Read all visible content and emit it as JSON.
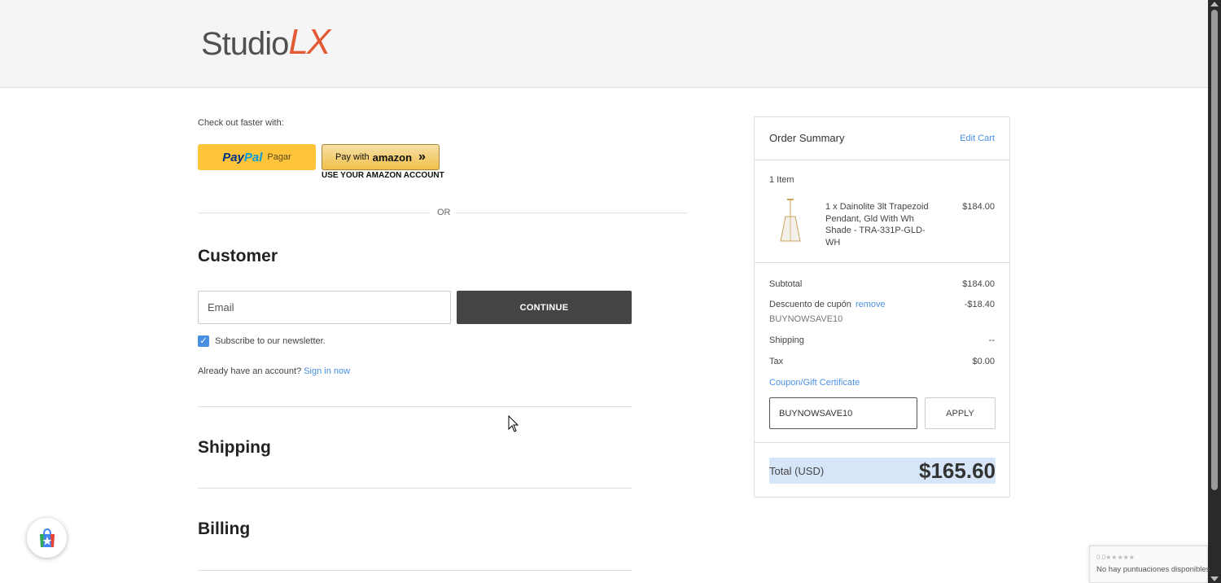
{
  "brand": {
    "logo_text_1": "Studio",
    "logo_text_2": "LX",
    "accent": "#e25b35"
  },
  "express": {
    "label": "Check out faster with:",
    "paypal_brand_1": "Pay",
    "paypal_brand_2": "Pal",
    "paypal_action": "Pagar",
    "amazon_prefix": "Pay with",
    "amazon_brand": "amazon",
    "amazon_sub": "USE YOUR AMAZON ACCOUNT",
    "or": "OR"
  },
  "customer": {
    "title": "Customer",
    "email_placeholder": "Email",
    "continue_label": "CONTINUE",
    "newsletter_label": "Subscribe to our newsletter.",
    "newsletter_checked": true,
    "account_prompt": "Already have an account?",
    "sign_in_label": "Sign in now"
  },
  "sections": {
    "shipping": "Shipping",
    "billing": "Billing"
  },
  "summary": {
    "title": "Order Summary",
    "edit_cart": "Edit Cart",
    "item_count": "1 Item",
    "item": {
      "name": "1 x Dainolite 3lt Trapezoid Pendant, Gld With Wh Shade - TRA-331P-GLD-WH",
      "price": "$184.00"
    },
    "subtotal_label": "Subtotal",
    "subtotal_value": "$184.00",
    "discount_label": "Descuento de cupón",
    "discount_remove": "remove",
    "discount_value": "-$18.40",
    "discount_code": "BUYNOWSAVE10",
    "shipping_label": "Shipping",
    "shipping_value": "--",
    "tax_label": "Tax",
    "tax_value": "$0.00",
    "coupon_link": "Coupon/Gift Certificate",
    "coupon_value": "BUYNOWSAVE10",
    "apply_label": "APPLY",
    "total_label": "Total (USD)",
    "total_value": "$165.60"
  },
  "recaptcha": {
    "stars": "0.0★★★★★",
    "text": "No hay puntuaciones disponibles"
  }
}
